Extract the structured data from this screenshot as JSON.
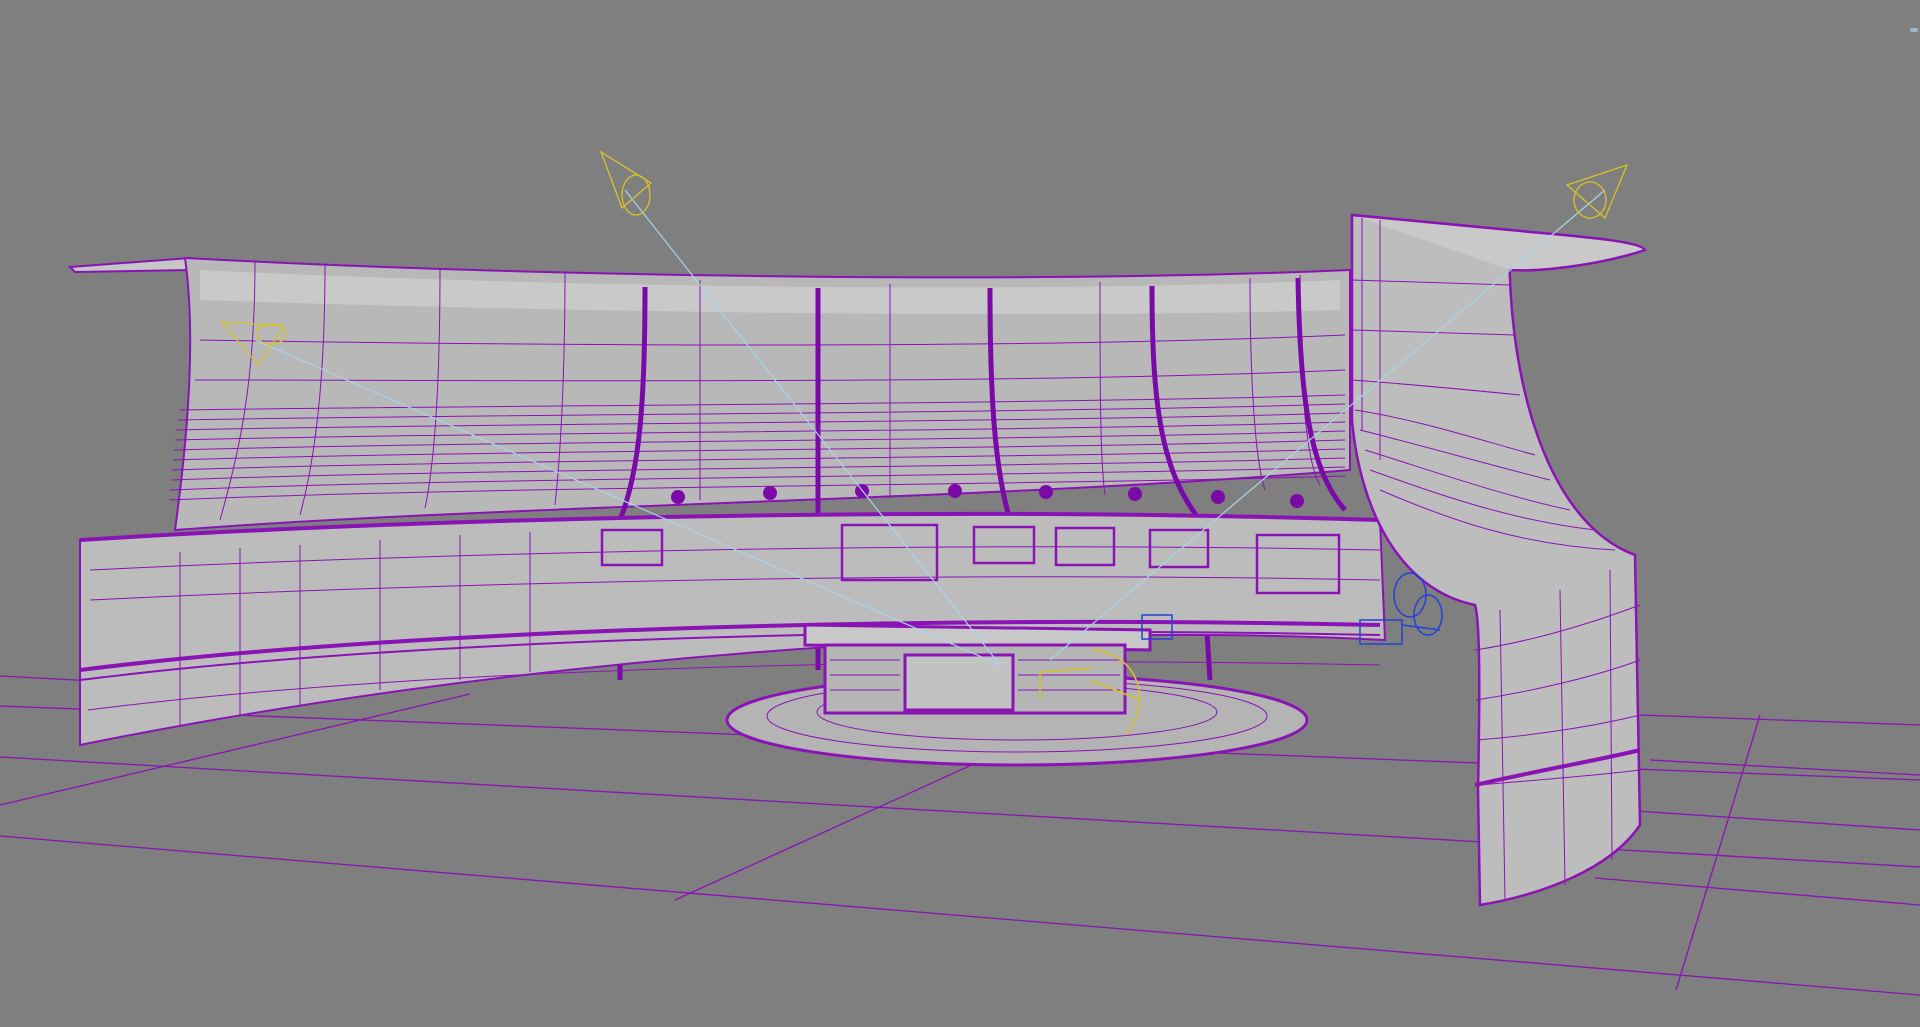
{
  "viewport": {
    "background_color": "#7f7f7f",
    "wire_color": "#8a13b5",
    "surface_color": "#b9b9b9",
    "light_color": "#d8c22a",
    "light_ray_color": "#a9d4e8",
    "camera_color": "#2342d6"
  },
  "scene": {
    "objects": [
      {
        "name": "curved-back-wall"
      },
      {
        "name": "right-curved-tower"
      },
      {
        "name": "lower-curved-wall"
      },
      {
        "name": "news-desk"
      },
      {
        "name": "circular-platform"
      },
      {
        "name": "wall-monitors"
      },
      {
        "name": "ceiling-spotlights"
      },
      {
        "name": "floor-grid"
      }
    ],
    "lights": [
      {
        "name": "spot-light-left",
        "icon": "spotlight-cone-icon"
      },
      {
        "name": "spot-light-top",
        "icon": "spotlight-cone-icon"
      },
      {
        "name": "spot-light-right",
        "icon": "spotlight-cone-icon"
      }
    ],
    "cameras": [
      {
        "name": "camera-right",
        "icon": "camera-icon"
      },
      {
        "name": "camera-center",
        "icon": "camera-target-icon"
      }
    ]
  }
}
